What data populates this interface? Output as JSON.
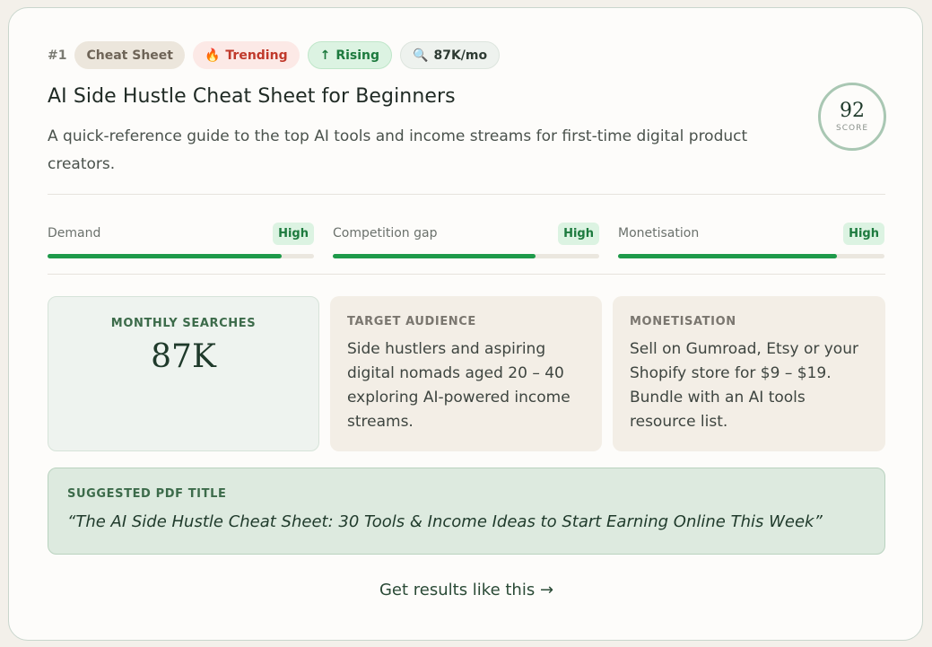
{
  "card": {
    "rank": "#1",
    "tags": {
      "category": "Cheat Sheet",
      "trending": "Trending",
      "trending_icon": "🔥",
      "rising": "Rising",
      "rising_icon": "↑",
      "volume": "87K/mo",
      "volume_icon": "🔍"
    },
    "title": "AI Side Hustle Cheat Sheet for Beginners",
    "description": "A quick-reference guide to the top AI tools and income streams for first-time digital product creators.",
    "score": {
      "value": "92",
      "label": "SCORE"
    },
    "metrics": [
      {
        "label": "Demand",
        "rating": "High",
        "level": 0.88
      },
      {
        "label": "Competition gap",
        "rating": "High",
        "level": 0.76
      },
      {
        "label": "Monetisation",
        "rating": "High",
        "level": 0.82
      }
    ],
    "panels": {
      "searches": {
        "heading": "MONTHLY SEARCHES",
        "value": "87K"
      },
      "audience": {
        "heading": "TARGET AUDIENCE",
        "body": "Side hustlers and aspiring digital nomads aged 20 – 40 exploring AI-powered income streams."
      },
      "monetisation": {
        "heading": "MONETISATION",
        "body": "Sell on Gumroad, Etsy or your Shopify store for $9 – $19. Bundle with an AI tools resource list."
      }
    },
    "suggested": {
      "heading": "SUGGESTED PDF TITLE",
      "title": "“The AI Side Hustle Cheat Sheet: 30 Tools & Income Ideas to Start Earning Online This Week”"
    },
    "cta": "Get results like this →"
  },
  "colors": {
    "accent": "#1e9a4a",
    "brand_dark": "#1f3a2b",
    "trending": "#c0392b"
  }
}
